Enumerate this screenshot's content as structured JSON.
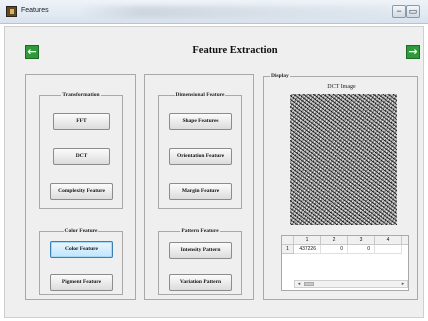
{
  "window": {
    "title": "Features",
    "minimize_glyph": "−",
    "maximize_glyph": "▭"
  },
  "header": {
    "title": "Feature Extraction",
    "back_glyph": "←",
    "forward_glyph": "→",
    "arrow_color": "#2f9a3a"
  },
  "transformation": {
    "title": "Transformation",
    "buttons": [
      "FFT",
      "DCT",
      "Complexity Feature"
    ]
  },
  "color_feature": {
    "title": "Color Feature",
    "buttons": [
      "Color Feature",
      "Pigment Feature"
    ],
    "active": "Color Feature"
  },
  "dimensional": {
    "title": "Dimensional Feature",
    "buttons": [
      "Shape Features",
      "Orientation Feature",
      "Margin Feature"
    ]
  },
  "pattern": {
    "title": "Pattern Feature",
    "buttons": [
      "Intensity Pattern",
      "Variation Pattern"
    ]
  },
  "display": {
    "title": "Display",
    "image_caption": "DCT Image",
    "table": {
      "columns": [
        "1",
        "2",
        "3",
        "4"
      ],
      "rows": [
        {
          "label": "1",
          "cells": [
            "437226",
            "0",
            "0",
            ""
          ]
        }
      ]
    }
  }
}
